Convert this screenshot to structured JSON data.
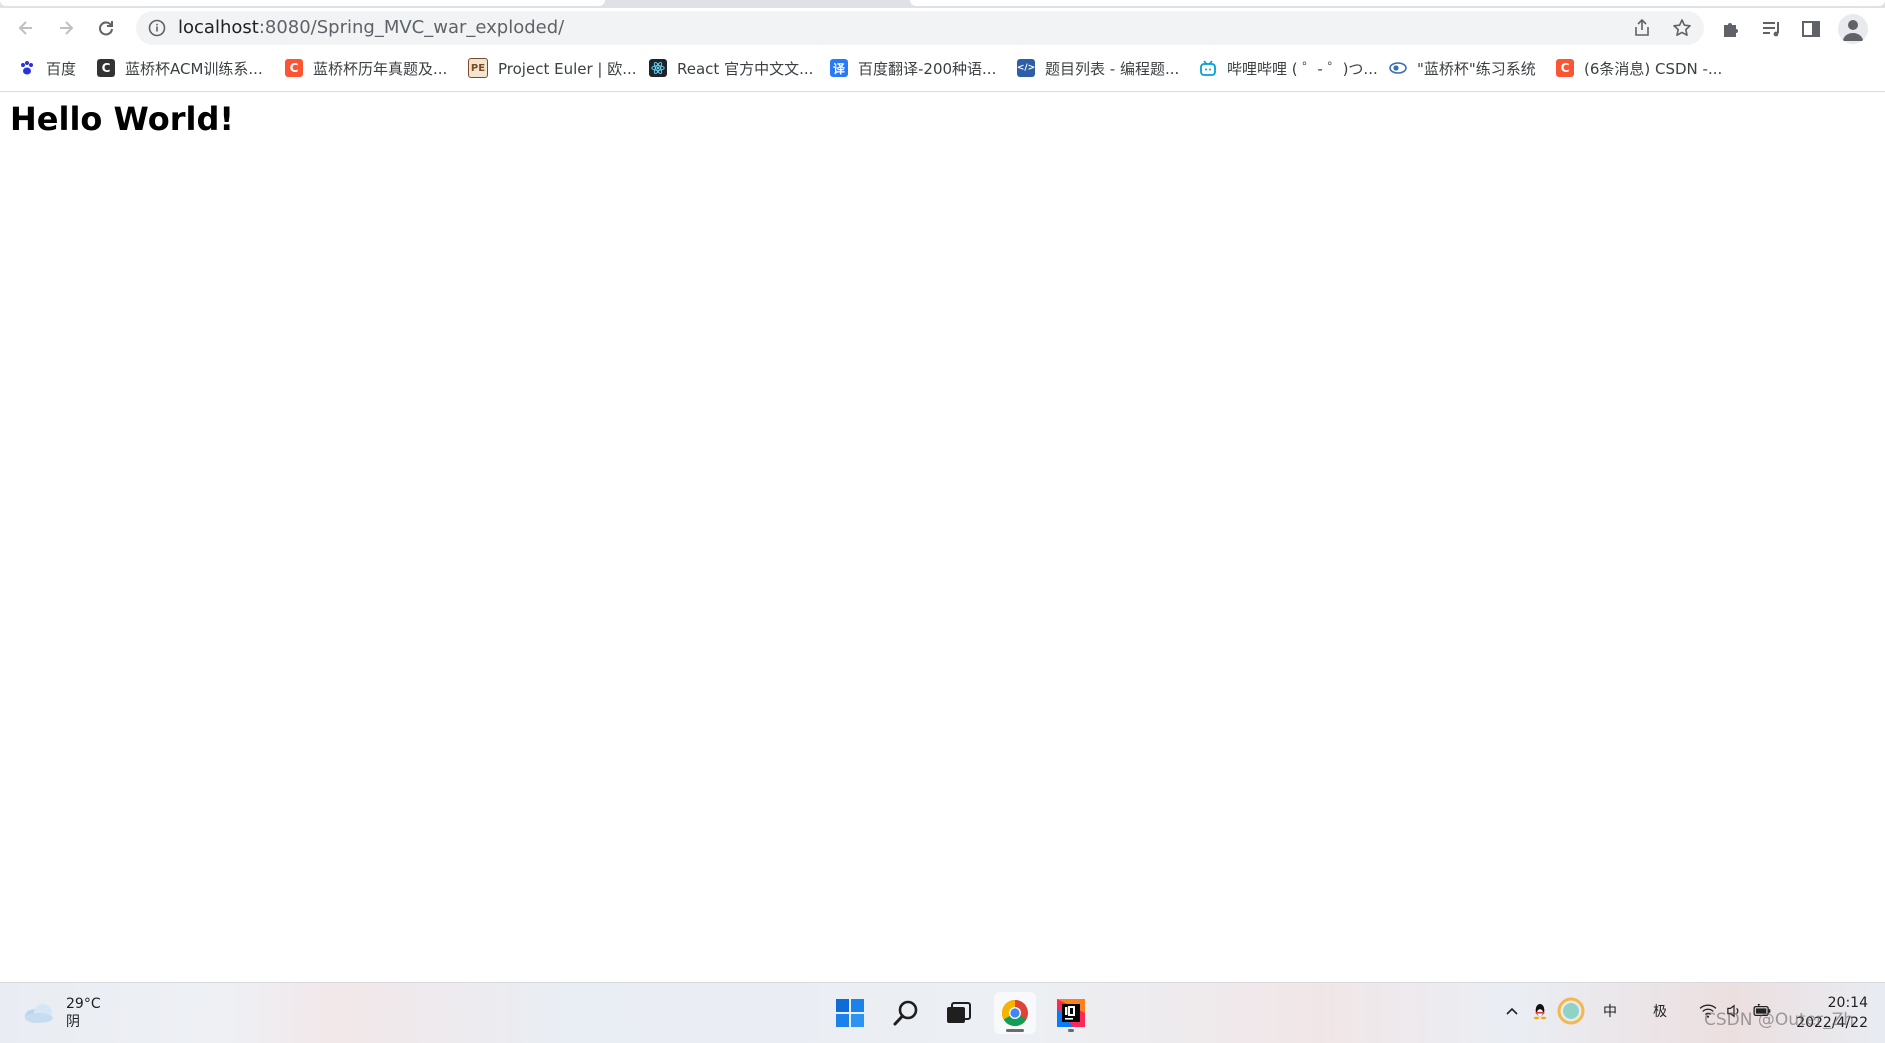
{
  "browser": {
    "url_host": "localhost",
    "url_rest": ":8080/Spring_MVC_war_exploded/",
    "bookmarks": [
      {
        "label": "百度",
        "icon": "baidu-paw-icon",
        "color": "#2932e1"
      },
      {
        "label": "蓝桥杯ACM训练系...",
        "icon": "lanqiao-c-icon",
        "color": "#333333"
      },
      {
        "label": "蓝桥杯历年真题及...",
        "icon": "csdn-c-icon",
        "color": "#fc5531"
      },
      {
        "label": "Project Euler | 欧...",
        "icon": "project-euler-icon",
        "color": "#7a4a2a"
      },
      {
        "label": "React 官方中文文...",
        "icon": "react-icon",
        "color": "#20232a"
      },
      {
        "label": "百度翻译-200种语...",
        "icon": "baidu-translate-icon",
        "color": "#2a7af6"
      },
      {
        "label": "题目列表 - 编程题...",
        "icon": "problem-list-icon",
        "color": "#2f5ea8"
      },
      {
        "label": "哔哩哔哩 ( ゜- ゜)つ...",
        "icon": "bilibili-icon",
        "color": "#00a1d6"
      },
      {
        "label": "\"蓝桥杯\"练习系统",
        "icon": "lanqiao-practice-icon",
        "color": "#3b6fb6"
      },
      {
        "label": "(6条消息) CSDN -...",
        "icon": "csdn-c-icon",
        "color": "#fc5531"
      }
    ]
  },
  "page": {
    "heading": "Hello World!"
  },
  "taskbar": {
    "weather_temp": "29°C",
    "weather_desc": "阴",
    "apps": [
      "windows-start-icon",
      "search-icon",
      "task-view-icon",
      "chrome-icon",
      "intellij-idea-icon"
    ],
    "tray_ime": "中",
    "tray_mode": "极",
    "time": "20:14",
    "date": "2022/4/22"
  },
  "watermark": "CSDN @Outer_Zh"
}
